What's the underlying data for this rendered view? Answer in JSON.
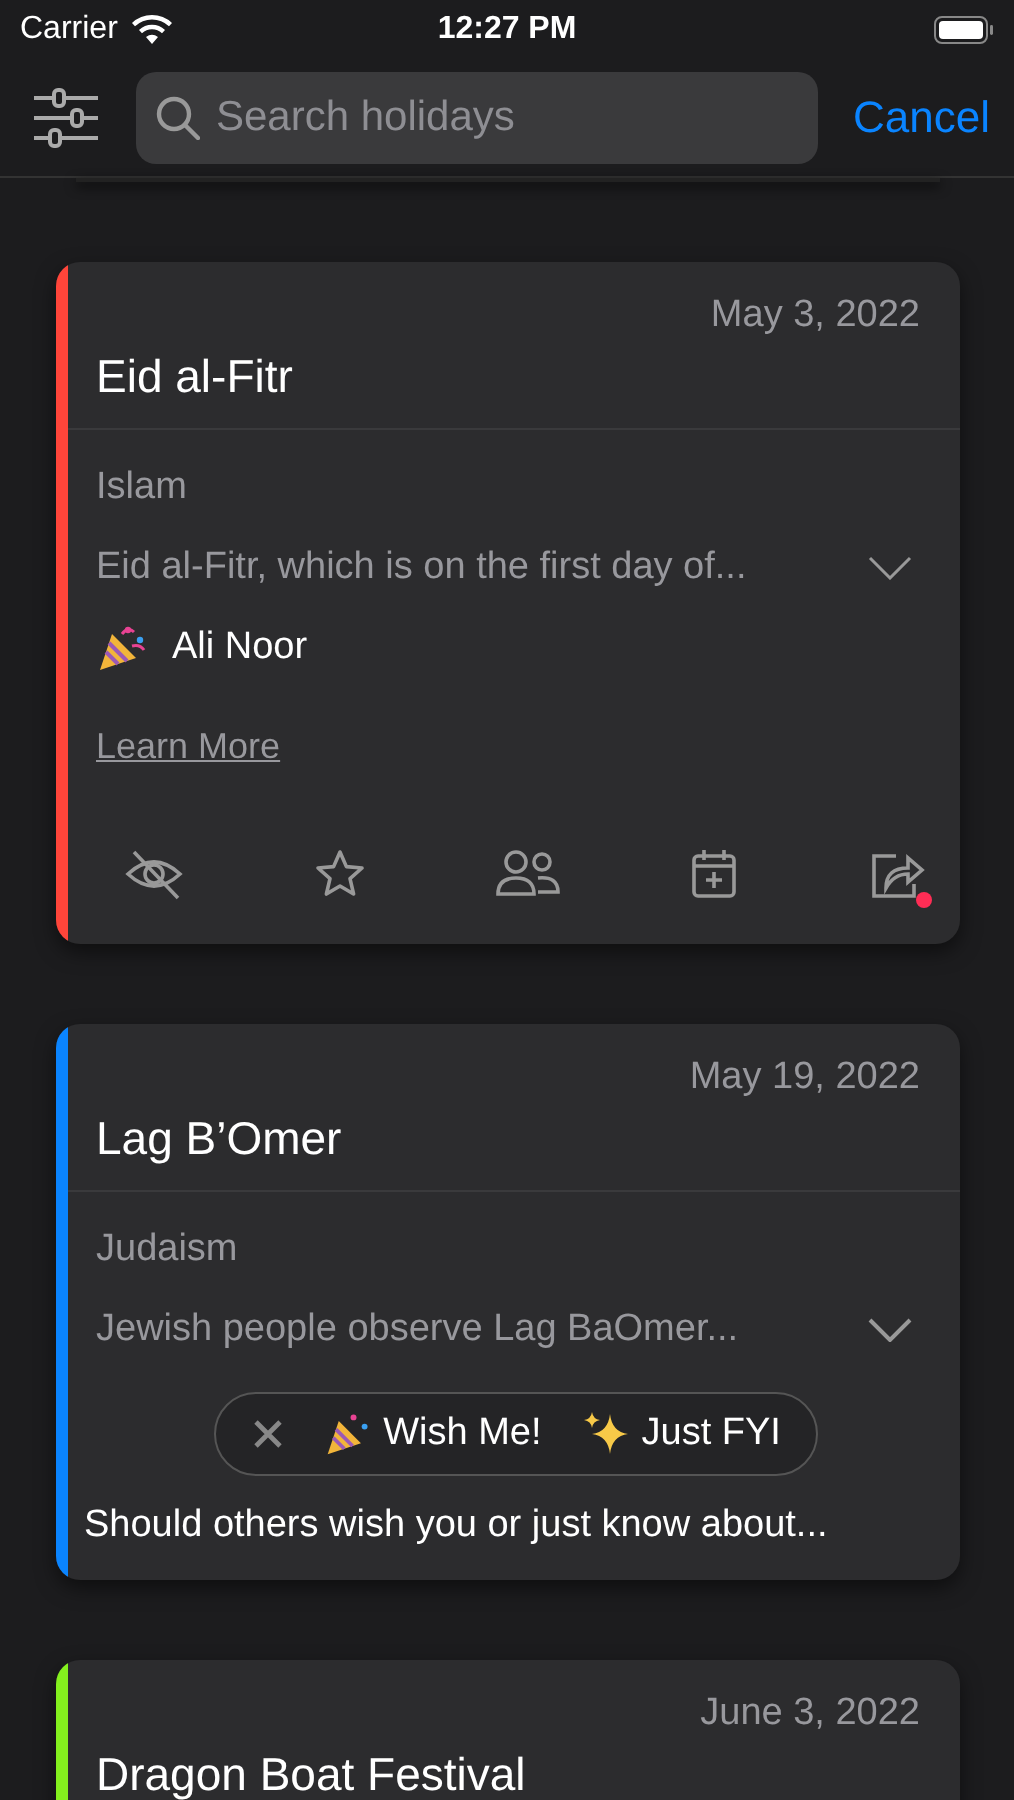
{
  "status_bar": {
    "carrier": "Carrier",
    "time": "12:27 PM"
  },
  "search": {
    "placeholder": "Search holidays",
    "cancel": "Cancel"
  },
  "cards": [
    {
      "color": "#ff453a",
      "date": "May 3, 2022",
      "title": "Eid al-Fitr",
      "category": "Islam",
      "description": "Eid al-Fitr, which is on the first day of...",
      "expanded": true,
      "wisher": "Ali Noor",
      "link": "Learn More",
      "actions": [
        {
          "kind": "hide",
          "notification": false
        },
        {
          "kind": "star",
          "notification": false
        },
        {
          "kind": "people",
          "notification": false
        },
        {
          "kind": "calendar-add",
          "notification": false
        },
        {
          "kind": "share",
          "notification": true
        }
      ]
    },
    {
      "color": "#0a84ff",
      "date": "May 19, 2022",
      "title": "Lag B’Omer",
      "category": "Judaism",
      "description": "Jewish people observe Lag BaOmer...",
      "expanded": false,
      "prompt": {
        "options": [
          {
            "kind": "wish",
            "label": "Wish Me!"
          },
          {
            "kind": "fyi",
            "label": "Just FYI"
          }
        ],
        "question": "Should others wish you or just know about..."
      }
    },
    {
      "color": "#84f01e",
      "date": "June 3, 2022",
      "title": "Dragon Boat Festival"
    }
  ]
}
